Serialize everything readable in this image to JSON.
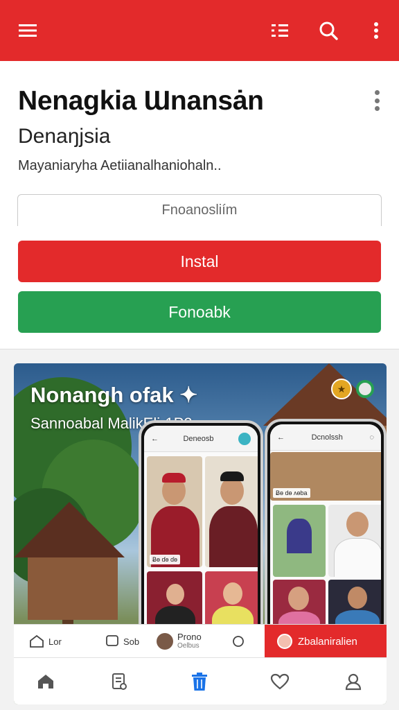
{
  "header": {
    "menu_icon": "hamburger-menu-icon",
    "filter_icon": "filter-list-icon",
    "search_icon": "search-icon",
    "more_icon": "more-vertical-icon",
    "color": "#e32a2b"
  },
  "app_card": {
    "title": "Nenagkia Ɯnansȧn",
    "subtitle": "Denaŋjsia",
    "description": "Mayaniaryha Aetiianalhaniohaln..",
    "field_value": "Fnoanosliím",
    "install_label": "Instal",
    "facebook_label": "Fonoabk",
    "install_color": "#e32a2b",
    "facebook_color": "#27a052"
  },
  "banner": {
    "title": "Nonangh ofak",
    "subtitle": "Sannoabal MalikEli-1P2",
    "phone_left": {
      "header_title": "Deneosb",
      "tile_caption": "Ƀɵ ɗɵ ɗɵ"
    },
    "phone_right": {
      "header_title": "Dcnolssh",
      "tile_caption": "Ƀɵ dɵ ʌɵba"
    },
    "mini_nav": {
      "item1": "Lor",
      "item2": "Sob",
      "profile_name": "Prono",
      "profile_sub": "Oelbus",
      "red_label": "Zbalaniralien"
    }
  },
  "bottom_nav": {
    "items": [
      "home-icon",
      "notes-icon",
      "trash-icon",
      "heart-icon",
      "profile-icon"
    ],
    "active_index": 2,
    "active_color": "#1a73e8"
  }
}
